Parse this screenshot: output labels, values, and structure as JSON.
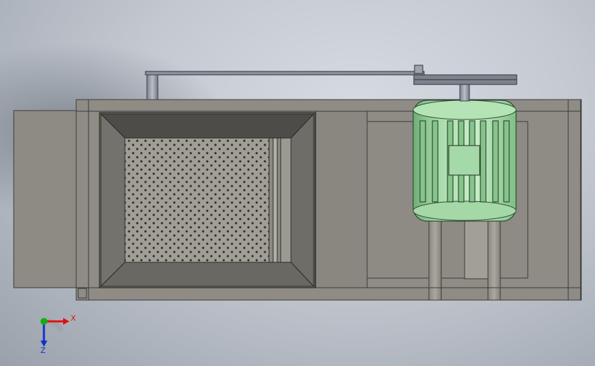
{
  "viewport": {
    "background": "#c4c9d1"
  },
  "model": {
    "parts": [
      "side-panel",
      "frame",
      "hopper",
      "perforated-screen",
      "motor-mount-plate",
      "electric-motor",
      "drive-belt",
      "motor-pulley",
      "driven-pulley-shaft",
      "motor-stand"
    ],
    "colors": {
      "frame": "#8f8c85",
      "panel": "#908d86",
      "hopper_dark": "#4e4c48",
      "screen": "#9a978f",
      "motor": "#9fd6a3",
      "belt": "#7a7f88"
    }
  },
  "triad": {
    "x_label": "X",
    "z_label": "Z",
    "colors": {
      "x": "#e01010",
      "y": "#10b010",
      "z": "#1030d0"
    }
  }
}
